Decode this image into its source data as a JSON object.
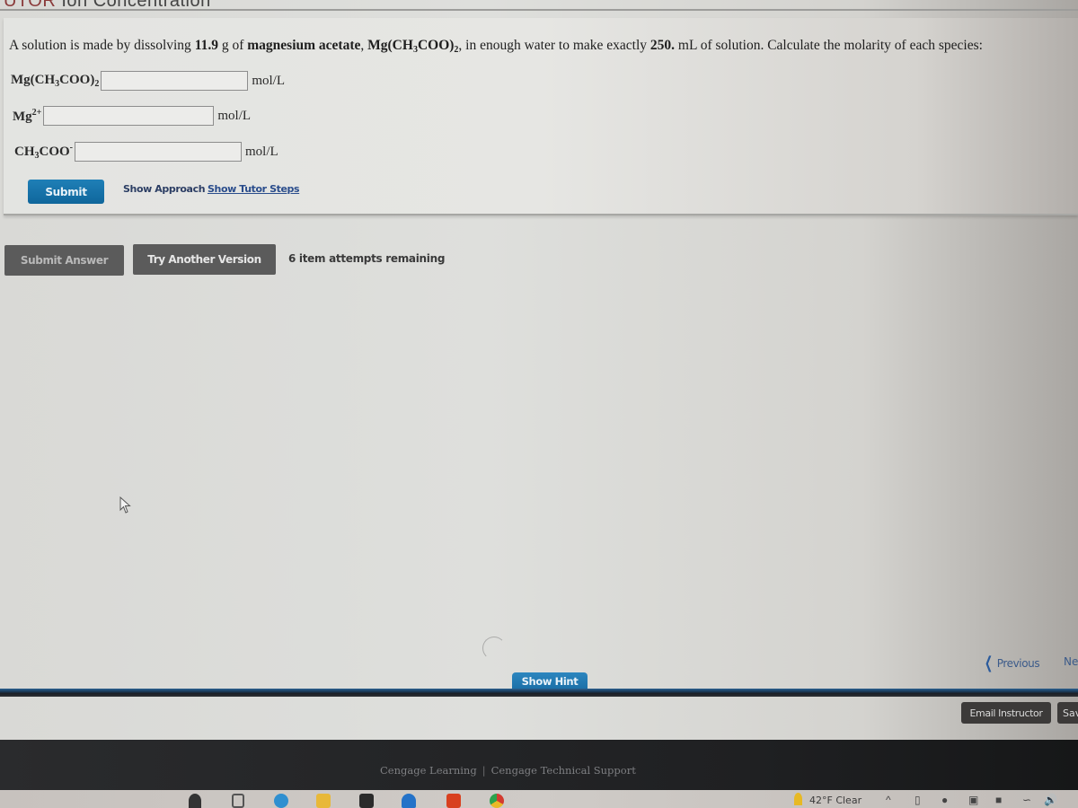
{
  "page": {
    "title_prefix": "UTOR",
    "title_rest": " Ion Concentration"
  },
  "question": {
    "prompt_parts": {
      "p1": "A solution is made by dissolving ",
      "mass": "11.9",
      "p2": " g of ",
      "compound_name": "magnesium acetate",
      "p3": ", ",
      "formula_a": "Mg(CH",
      "formula_sub1": "3",
      "formula_b": "COO)",
      "formula_sub2": "2",
      "p4": ", in enough water to make exactly ",
      "volume": "250.",
      "p5": " mL of solution. Calculate the molarity of each species:"
    },
    "rows": [
      {
        "species": "Mg(CH3COO)2",
        "label_a": "Mg(CH",
        "label_sub1": "3",
        "label_b": "COO)",
        "label_sub2": "2",
        "value": "",
        "placeholder": "",
        "unit": "mol/L"
      },
      {
        "species": "Mg2+",
        "label_a": "Mg",
        "label_sup": "2+",
        "value": "",
        "placeholder": "",
        "unit": "mol/L"
      },
      {
        "species": "CH3COO-",
        "label_a": "CH",
        "label_sub1": "3",
        "label_b": "COO",
        "label_sup": "-",
        "value": "",
        "placeholder": "",
        "unit": "mol/L"
      }
    ],
    "submit_label": "Submit",
    "show_approach_label": "Show Approach",
    "show_tutor_steps_label": "Show Tutor Steps"
  },
  "actions": {
    "submit_answer_label": "Submit Answer",
    "try_another_label": "Try Another Version",
    "attempts_text": "6 item attempts remaining"
  },
  "navigation": {
    "show_hint_label": "Show Hint",
    "previous_label": "Previous",
    "next_label": "Next",
    "email_instructor_label": "Email Instructor",
    "save_label": "Save"
  },
  "footer": {
    "link1": "Cengage Learning",
    "separator": "|",
    "link2": "Cengage Technical Support"
  },
  "taskbar": {
    "weather_text": "42°F  Clear",
    "colors": {
      "edge": "#2f8fd0",
      "folder": "#e8b838",
      "store": "#2b2b2b",
      "mail": "#2472c8",
      "office": "#d8401f",
      "chrome": "#d33b2f"
    }
  },
  "theme": {
    "accent_blue": "#1a72a8",
    "nav_bar_dark": "#1b1f25",
    "button_dark": "#5b5b5b",
    "footer_bg": "#1f2022"
  }
}
